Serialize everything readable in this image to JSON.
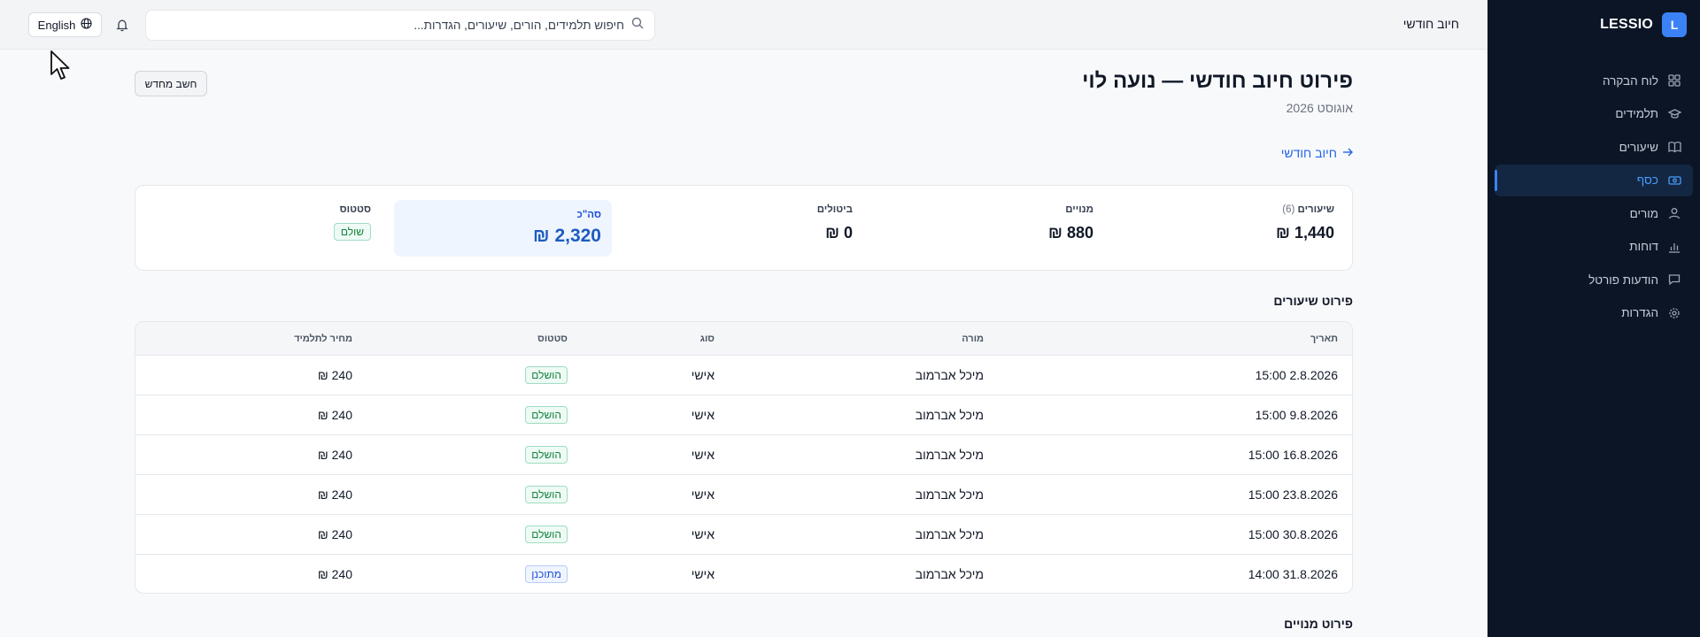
{
  "brand": {
    "badge": "L",
    "name": "LESSIO"
  },
  "sidebar": {
    "items": [
      {
        "label": "לוח הבקרה",
        "icon": "dashboard-icon",
        "active": false
      },
      {
        "label": "תלמידים",
        "icon": "graduation-cap-icon",
        "active": false
      },
      {
        "label": "שיעורים",
        "icon": "book-icon",
        "active": false
      },
      {
        "label": "כסף",
        "icon": "money-icon",
        "active": true
      },
      {
        "label": "מורים",
        "icon": "user-icon",
        "active": false
      },
      {
        "label": "דוחות",
        "icon": "bar-chart-icon",
        "active": false
      },
      {
        "label": "הודעות פורטל",
        "icon": "message-icon",
        "active": false
      },
      {
        "label": "הגדרות",
        "icon": "gear-icon",
        "active": false
      }
    ]
  },
  "topbar": {
    "crumb": "חיוב חודשי",
    "search_placeholder": "חיפוש תלמידים, הורים, שיעורים, הגדרות...",
    "language_label": "English"
  },
  "header": {
    "title": "פירוט חיוב חודשי — נועה לוי",
    "subtitle": "אוגוסט 2026",
    "recalc_label": "חשב מחדש",
    "back_link": "חיוב חודשי"
  },
  "summary": {
    "lessons_label": "שיעורים",
    "lessons_count": "(6)",
    "lessons_value": "1,440 ₪",
    "subscriptions_label": "מנויים",
    "subscriptions_value": "880 ₪",
    "cancellations_label": "ביטולים",
    "cancellations_value": "0 ₪",
    "total_label": "סה\"כ",
    "total_value": "2,320 ₪",
    "status_label": "סטטוס",
    "status_value": "שולם"
  },
  "lessons_section": {
    "title": "פירוט שיעורים",
    "columns": {
      "date": "תאריך",
      "teacher": "מורה",
      "type": "סוג",
      "status": "סטטוס",
      "price": "מחיר לתלמיד"
    },
    "rows": [
      {
        "date": "2.8.2026 15:00",
        "teacher": "מיכל אברמוב",
        "type": "אישי",
        "status": "הושלם",
        "status_kind": "done",
        "price": "240 ₪"
      },
      {
        "date": "9.8.2026 15:00",
        "teacher": "מיכל אברמוב",
        "type": "אישי",
        "status": "הושלם",
        "status_kind": "done",
        "price": "240 ₪"
      },
      {
        "date": "16.8.2026 15:00",
        "teacher": "מיכל אברמוב",
        "type": "אישי",
        "status": "הושלם",
        "status_kind": "done",
        "price": "240 ₪"
      },
      {
        "date": "23.8.2026 15:00",
        "teacher": "מיכל אברמוב",
        "type": "אישי",
        "status": "הושלם",
        "status_kind": "done",
        "price": "240 ₪"
      },
      {
        "date": "30.8.2026 15:00",
        "teacher": "מיכל אברמוב",
        "type": "אישי",
        "status": "הושלם",
        "status_kind": "done",
        "price": "240 ₪"
      },
      {
        "date": "31.8.2026 14:00",
        "teacher": "מיכל אברמוב",
        "type": "אישי",
        "status": "מתוכנן",
        "status_kind": "planned",
        "price": "240 ₪"
      }
    ]
  },
  "subscriptions_section": {
    "title": "פירוט מנויים"
  },
  "colors": {
    "accent": "#3b82f6",
    "sidebar_bg": "#0b1526",
    "link": "#2563eb",
    "success": "#15803d"
  }
}
